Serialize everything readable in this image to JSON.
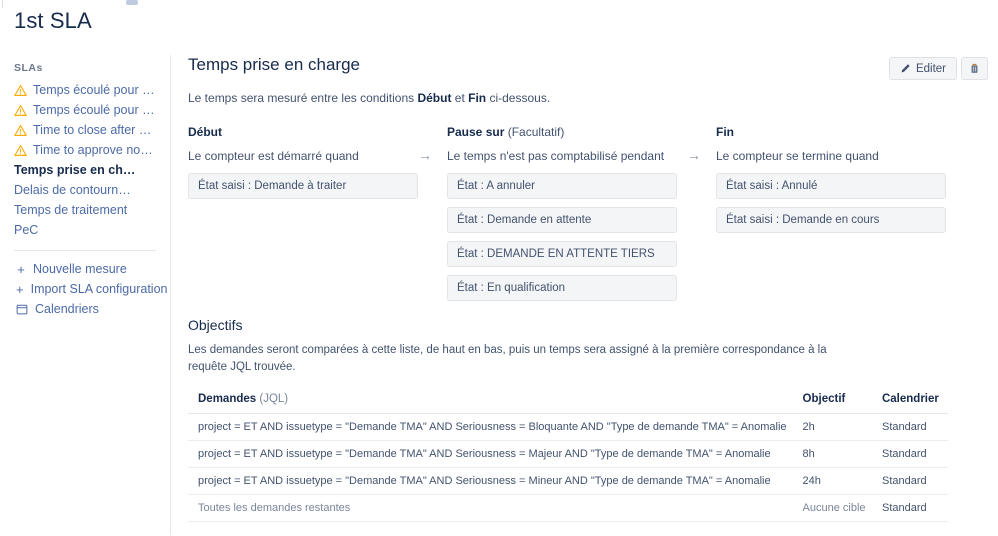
{
  "page": {
    "title": "1st SLA"
  },
  "sidebar": {
    "heading": "SLAs",
    "items": [
      {
        "label": "Temps écoulé pour la ...",
        "icon": "warning-icon",
        "selected": false
      },
      {
        "label": "Temps écoulé pour la ...",
        "icon": "warning-icon",
        "selected": false
      },
      {
        "label": "Time to close after res...",
        "icon": "warning-icon",
        "selected": false
      },
      {
        "label": "Time to approve norm...",
        "icon": "warning-icon",
        "selected": false
      },
      {
        "label": "Temps prise en charge",
        "icon": "",
        "selected": true
      },
      {
        "label": "Delais de contournement",
        "icon": "",
        "selected": false
      },
      {
        "label": "Temps de traitement",
        "icon": "",
        "selected": false
      },
      {
        "label": "PeC",
        "icon": "",
        "selected": false
      }
    ],
    "actions": [
      {
        "label": "Nouvelle mesure",
        "icon": "plus-icon"
      },
      {
        "label": "Import SLA configuration",
        "icon": "plus-icon"
      },
      {
        "label": "Calendriers",
        "icon": "calendar-icon"
      }
    ]
  },
  "main": {
    "title": "Temps prise en charge",
    "description_pre": "Le temps sera mesuré entre les conditions ",
    "description_bold1": "Début",
    "description_mid": " et ",
    "description_bold2": "Fin",
    "description_post": " ci-dessous.",
    "edit_label": "Editer",
    "arrow_glyph": "→"
  },
  "columns": {
    "start": {
      "heading": "Début",
      "subtitle": "Le compteur est démarré quand",
      "chips": [
        "État saisi : Demande à traiter"
      ]
    },
    "pause": {
      "heading": "Pause sur",
      "optional": " (Facultatif)",
      "subtitle": "Le temps n'est pas comptabilisé pendant",
      "chips": [
        "État : A annuler",
        "État : Demande en attente",
        "État : DEMANDE EN ATTENTE TIERS",
        "État : En qualification"
      ]
    },
    "end": {
      "heading": "Fin",
      "subtitle": "Le compteur se termine quand",
      "chips": [
        "État saisi : Annulé",
        "État saisi : Demande en cours"
      ]
    }
  },
  "objectifs": {
    "title": "Objectifs",
    "description": "Les demandes seront comparées à cette liste, de haut en bas, puis un temps sera assigné à la première correspondance à la requête JQL trouvée.",
    "table": {
      "headers": {
        "demandes": "Demandes",
        "demandes_jql": " (JQL)",
        "objectif": "Objectif",
        "calendrier": "Calendrier"
      },
      "rows": [
        {
          "query": "project = ET AND issuetype = \"Demande TMA\" AND Seriousness = Bloquante AND \"Type de demande TMA\" = Anomalie",
          "objectif": "2h",
          "calendrier": "Standard",
          "muted": false
        },
        {
          "query": "project = ET AND issuetype = \"Demande TMA\" AND Seriousness = Majeur AND \"Type de demande TMA\" = Anomalie",
          "objectif": "8h",
          "calendrier": "Standard",
          "muted": false
        },
        {
          "query": "project = ET AND issuetype = \"Demande TMA\" AND Seriousness = Mineur AND \"Type de demande TMA\" = Anomalie",
          "objectif": "24h",
          "calendrier": "Standard",
          "muted": false
        },
        {
          "query": "Toutes les demandes restantes",
          "objectif": "Aucune cible",
          "calendrier": "Standard",
          "muted": true
        }
      ]
    }
  },
  "colors": {
    "link": "#4c6aa8",
    "warning": "#ffab00",
    "text": "#172b4d",
    "muted": "#7a869a",
    "chip_bg": "#f4f5f7"
  }
}
